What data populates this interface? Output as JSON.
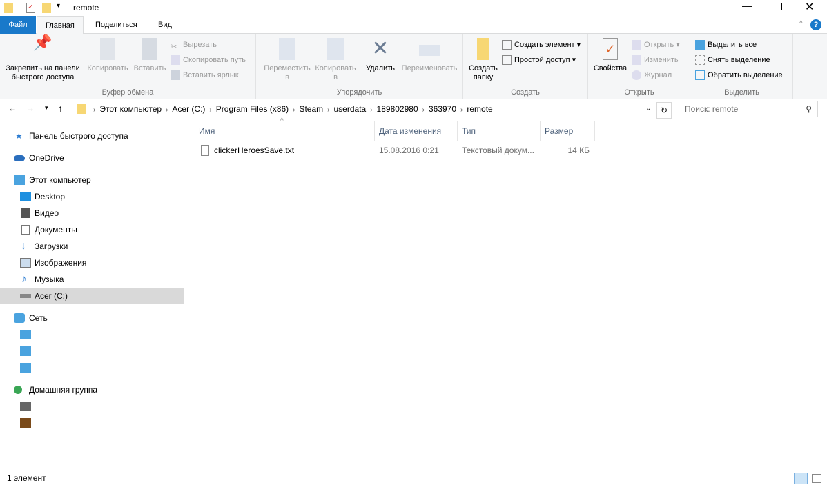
{
  "window": {
    "title": "remote"
  },
  "tabs": [
    "Файл",
    "Главная",
    "Поделиться",
    "Вид"
  ],
  "ribbon": {
    "clipboard": {
      "label": "Буфер обмена",
      "pin": "Закрепить на панели быстрого доступа",
      "copy": "Копировать",
      "paste": "Вставить",
      "cut": "Вырезать",
      "copy_path": "Скопировать путь",
      "paste_shortcut": "Вставить ярлык"
    },
    "organize": {
      "label": "Упорядочить",
      "move": "Переместить в",
      "copy_to": "Копировать в",
      "delete": "Удалить",
      "rename": "Переименовать"
    },
    "new": {
      "label": "Создать",
      "new_folder": "Создать папку",
      "new_item": "Создать элемент",
      "easy_access": "Простой доступ"
    },
    "open": {
      "label": "Открыть",
      "properties": "Свойства",
      "open": "Открыть",
      "edit": "Изменить",
      "history": "Журнал"
    },
    "select": {
      "label": "Выделить",
      "select_all": "Выделить все",
      "select_none": "Снять выделение",
      "invert": "Обратить выделение"
    }
  },
  "address": {
    "crumbs": [
      "Этот компьютер",
      "Acer (C:)",
      "Program Files (x86)",
      "Steam",
      "userdata",
      "189802980",
      "363970",
      "remote"
    ]
  },
  "search": {
    "placeholder": "Поиск: remote"
  },
  "nav": [
    {
      "label": "Панель быстрого доступа",
      "icon": "star-icon"
    },
    {
      "label": "OneDrive",
      "icon": "cloud-icon"
    },
    {
      "label": "Этот компьютер",
      "icon": "computer-icon"
    },
    {
      "label": "Desktop",
      "icon": "desktop-icon"
    },
    {
      "label": "Видео",
      "icon": "video-icon"
    },
    {
      "label": "Документы",
      "icon": "documents-icon"
    },
    {
      "label": "Загрузки",
      "icon": "downloads-icon"
    },
    {
      "label": "Изображения",
      "icon": "pictures-icon"
    },
    {
      "label": "Музыка",
      "icon": "music-icon"
    },
    {
      "label": "Acer (C:)",
      "icon": "drive-icon"
    },
    {
      "label": "Сеть",
      "icon": "network-icon"
    },
    {
      "label": "Домашняя группа",
      "icon": "homegroup-icon"
    }
  ],
  "columns": [
    "Имя",
    "Дата изменения",
    "Тип",
    "Размер"
  ],
  "files": [
    {
      "name": "clickerHeroesSave.txt",
      "date": "15.08.2016 0:21",
      "type": "Текстовый докум...",
      "size": "14 КБ"
    }
  ],
  "status": "1 элемент"
}
